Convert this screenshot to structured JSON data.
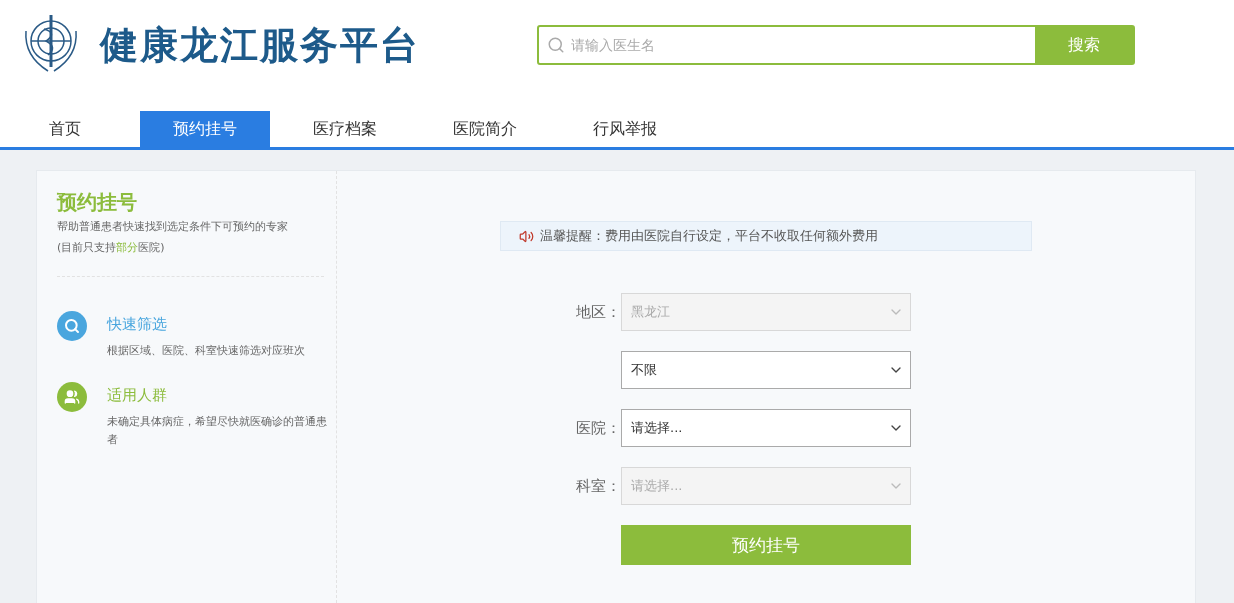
{
  "header": {
    "site_title": "健康龙江服务平台",
    "search": {
      "placeholder": "请输入医生名",
      "button": "搜索"
    }
  },
  "nav": [
    {
      "label": "首页",
      "selected": false
    },
    {
      "label": "预约挂号",
      "selected": true
    },
    {
      "label": "医疗档案",
      "selected": false
    },
    {
      "label": "医院简介",
      "selected": false
    },
    {
      "label": "行风举报",
      "selected": false
    }
  ],
  "sidebar": {
    "title": "预约挂号",
    "description": "帮助普通患者快速找到选定条件下可预约的专家",
    "note": {
      "before": "(目前只支持",
      "highlight": "部分",
      "after": "医院)"
    },
    "features": [
      {
        "kind": "search",
        "title": "快速筛选",
        "text": "根据区域、医院、科室快速筛选对应班次",
        "color": "#4aa6de"
      },
      {
        "kind": "people",
        "title": "适用人群",
        "text": "未确定具体病症，希望尽快就医确诊的普通患者",
        "color": "#8cbc3c"
      }
    ]
  },
  "notice": "温馨提醒：费用由医院自行设定，平台不收取任何额外费用",
  "form": {
    "fields": [
      {
        "label": "地区：",
        "value": "黑龙江",
        "disabled": true
      },
      {
        "value": "不限",
        "disabled": false
      },
      {
        "label": "医院：",
        "value": "请选择...",
        "disabled": false
      },
      {
        "label": "科室：",
        "value": "请选择...",
        "disabled": true
      }
    ],
    "submit": "预约挂号"
  }
}
